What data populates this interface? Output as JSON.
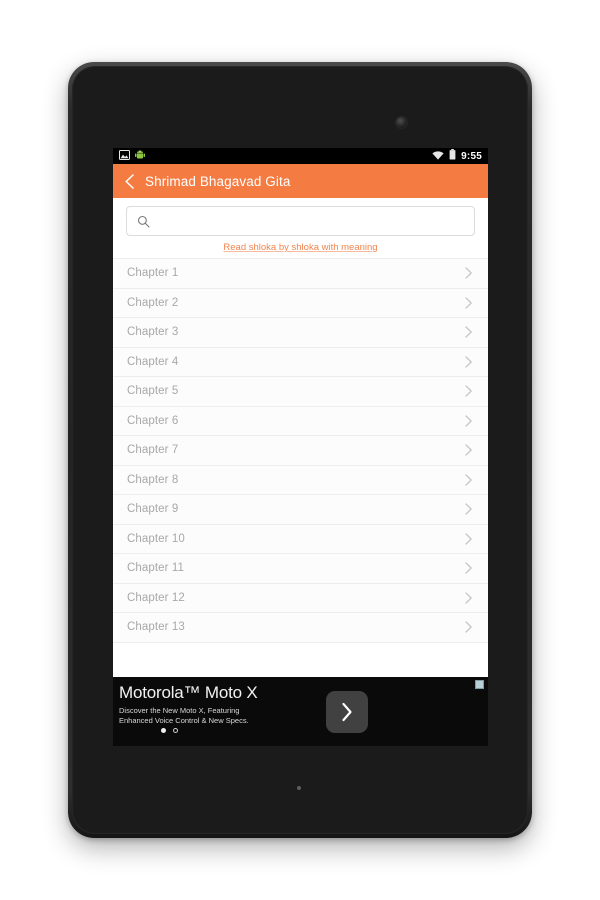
{
  "device": {
    "camera_icon": "front-camera-icon",
    "speaker_dot_icon": "bottom-dot-icon"
  },
  "status_bar": {
    "time": "9:55",
    "left_icons": [
      "screenshot-icon",
      "android-icon"
    ],
    "right_icons": [
      "wifi-icon",
      "battery-icon"
    ]
  },
  "app_bar": {
    "back_icon": "back-chevron-icon",
    "title": "Shrimad Bhagavad Gita",
    "background_color": "#f47b42"
  },
  "search": {
    "icon": "search-icon",
    "value": "",
    "placeholder": ""
  },
  "tagline": {
    "text": "Read shloka by shloka with meaning",
    "color": "#f0854f"
  },
  "chapter_list": {
    "row_chevron_icon": "chevron-right-icon",
    "items": [
      {
        "label": "Chapter 1"
      },
      {
        "label": "Chapter 2"
      },
      {
        "label": "Chapter 3"
      },
      {
        "label": "Chapter 4"
      },
      {
        "label": "Chapter 5"
      },
      {
        "label": "Chapter 6"
      },
      {
        "label": "Chapter 7"
      },
      {
        "label": "Chapter 8"
      },
      {
        "label": "Chapter 9"
      },
      {
        "label": "Chapter 10"
      },
      {
        "label": "Chapter 11"
      },
      {
        "label": "Chapter 12"
      },
      {
        "label": "Chapter 13"
      }
    ]
  },
  "ad": {
    "title": "Motorola™ Moto X",
    "subtitle_line1": "Discover the New Moto X, Featuring",
    "subtitle_line2": "Enhanced Voice Control & New Specs.",
    "cta_icon": "chevron-right-icon",
    "adchoices_icon": "adchoices-icon",
    "dots": [
      "active",
      "inactive"
    ]
  },
  "nav_bar": {
    "back_icon": "nav-back-triangle-icon",
    "home_icon": "nav-home-circle-icon",
    "recents_icon": "nav-recents-square-icon"
  }
}
